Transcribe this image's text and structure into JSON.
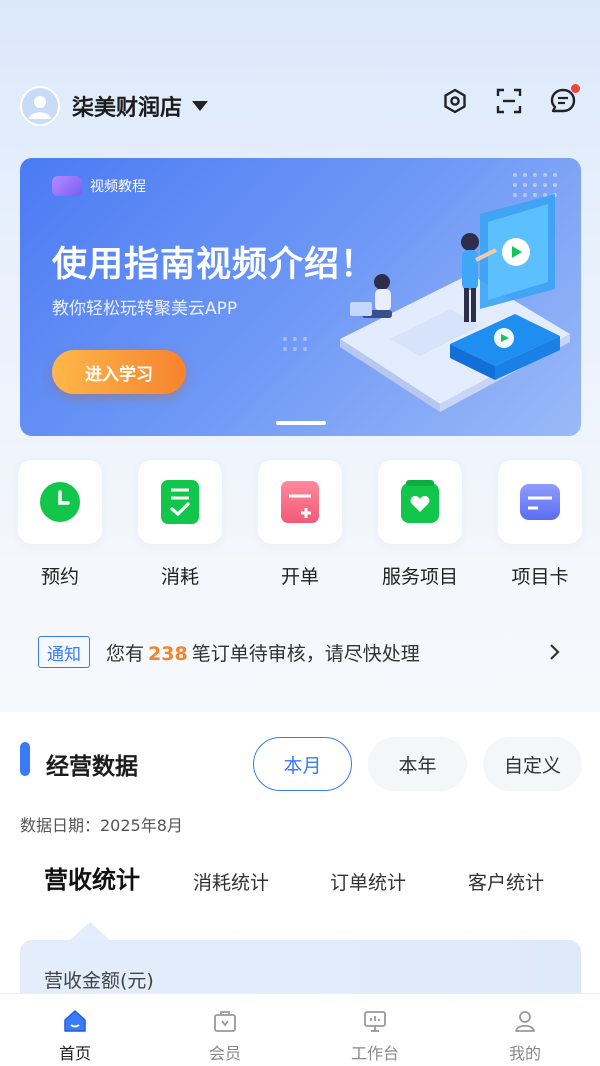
{
  "header": {
    "store_name": "柒美财润店",
    "icons": [
      "settings-icon",
      "scan-icon",
      "message-icon"
    ],
    "has_unread": true
  },
  "banner": {
    "tag": "视频教程",
    "title": "使用指南视频介绍！",
    "subtitle": "教你轻松玩转聚美云APP",
    "button": "进入学习"
  },
  "quick_actions": [
    {
      "label": "预约",
      "icon": "clock-icon"
    },
    {
      "label": "消耗",
      "icon": "checklist-icon"
    },
    {
      "label": "开单",
      "icon": "add-order-icon"
    },
    {
      "label": "服务项目",
      "icon": "heart-card-icon"
    },
    {
      "label": "项目卡",
      "icon": "card-icon"
    }
  ],
  "notice": {
    "tag": "通知",
    "prefix": "您有",
    "count": "238",
    "suffix": "笔订单待审核，请尽快处理"
  },
  "business": {
    "title": "经营数据",
    "periods": [
      "本月",
      "本年",
      "自定义"
    ],
    "active_period": "本月",
    "date_line": "数据日期：2025年8月",
    "stat_tabs": [
      "营收统计",
      "消耗统计",
      "订单统计",
      "客户统计"
    ],
    "active_stat_tab": "营收统计",
    "card_label": "营收金额(元)"
  },
  "tabbar": [
    {
      "label": "首页",
      "icon": "home-icon",
      "active": true
    },
    {
      "label": "会员",
      "icon": "member-icon",
      "active": false
    },
    {
      "label": "工作台",
      "icon": "workbench-icon",
      "active": false
    },
    {
      "label": "我的",
      "icon": "profile-icon",
      "active": false
    }
  ],
  "colors": {
    "accent": "#3a7bf5",
    "orange": "#f7832e",
    "green": "#12c64b"
  }
}
